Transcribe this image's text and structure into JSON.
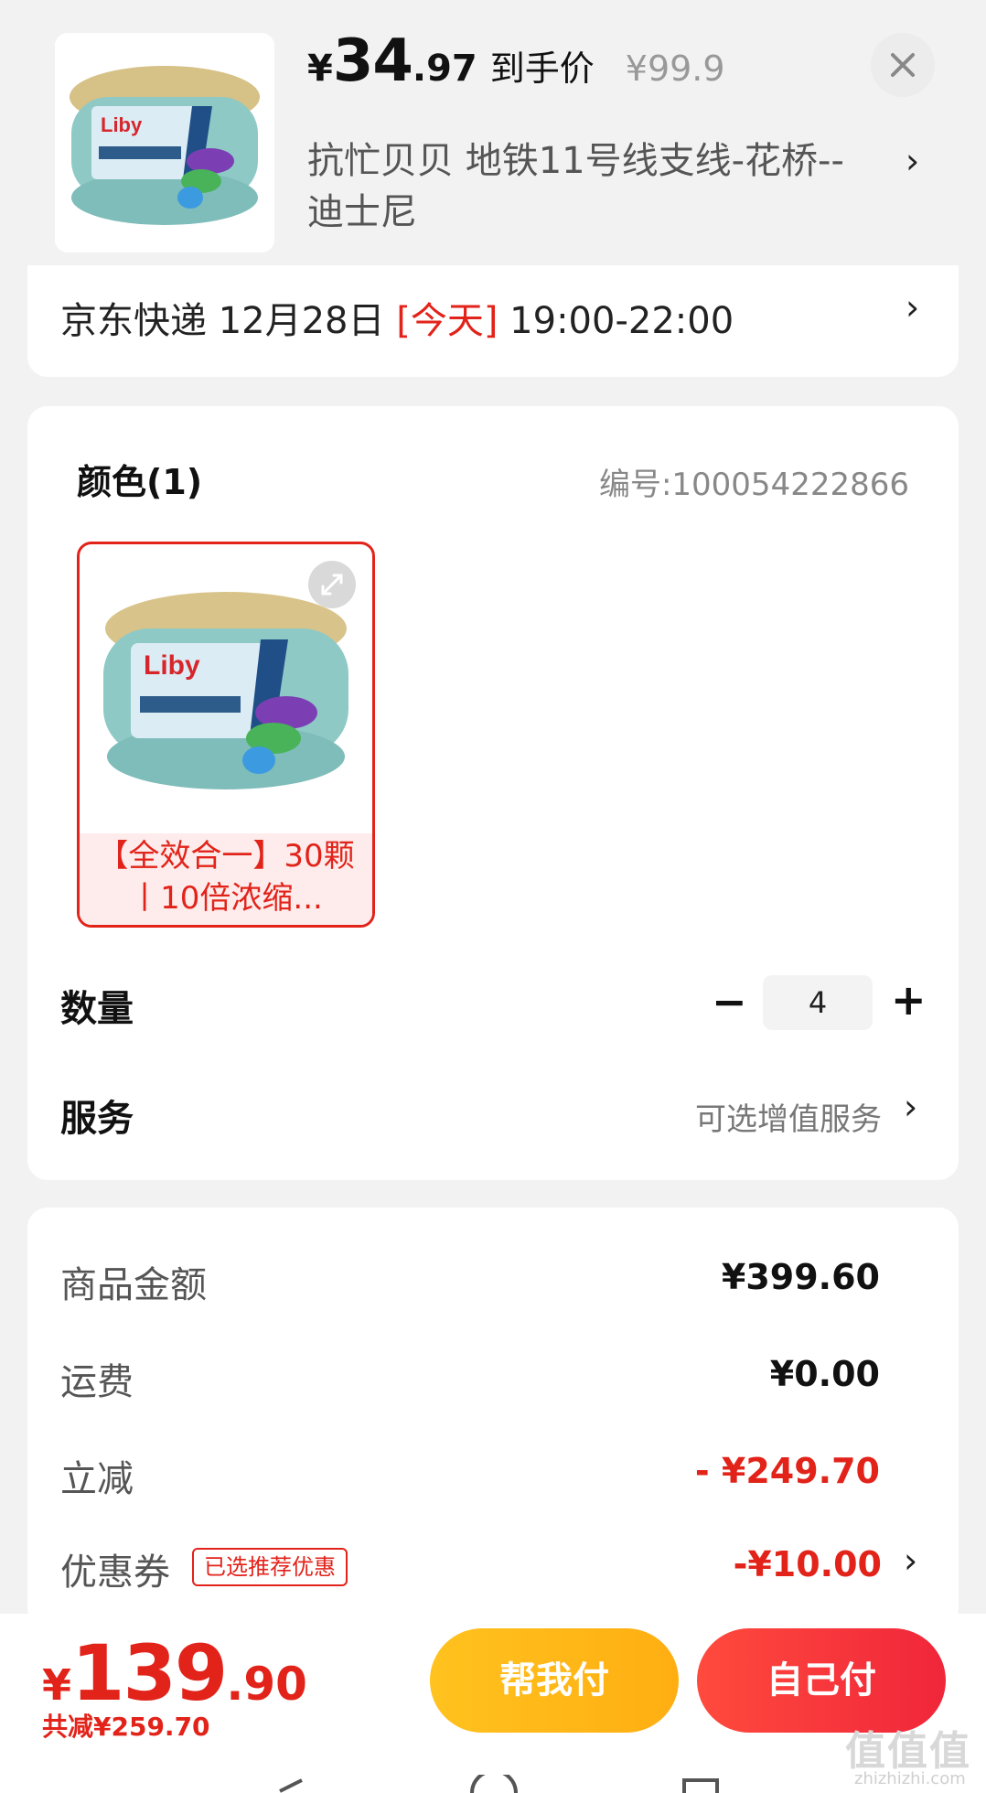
{
  "product": {
    "price_symbol": "¥",
    "price_int": "34",
    "price_dec": ".97",
    "price_tag": "到手价",
    "original_price": "¥99.9",
    "brand_logo": "Liby"
  },
  "address": {
    "text": "抗忙贝贝  地铁11号线支线-花桥--迪士尼"
  },
  "delivery": {
    "carrier": "京东快递 12月28日 ",
    "today": "[今天]",
    "window": " 19:00-22:00"
  },
  "selection": {
    "color_label": "颜色(1)",
    "sku_number": "编号:100054222866",
    "sku_caption": "【全效合一】30颗丨10倍浓缩...",
    "quantity_label": "数量",
    "quantity_minus": "−",
    "quantity_value": "4",
    "quantity_plus": "+",
    "service_label": "服务",
    "service_value": "可选增值服务"
  },
  "summary": {
    "goods_label": "商品金额",
    "goods_value": "¥399.60",
    "shipping_label": "运费",
    "shipping_value": "¥0.00",
    "discount_label": "立减",
    "discount_value": "- ¥249.70",
    "coupon_label": "优惠券",
    "coupon_tag": "已选推荐优惠",
    "coupon_value": "-¥10.00"
  },
  "footer": {
    "total_symbol": "¥",
    "total_int": "139",
    "total_dec": ".90",
    "total_saving": "共减¥259.70",
    "help_pay": "帮我付",
    "self_pay": "自己付",
    "watermark": "值值值",
    "watermark_sub": "zhizhizhi.com"
  },
  "colors": {
    "accent_red": "#e2231a",
    "help_yellow": "#ffb81a",
    "self_red": "#f0263a"
  }
}
